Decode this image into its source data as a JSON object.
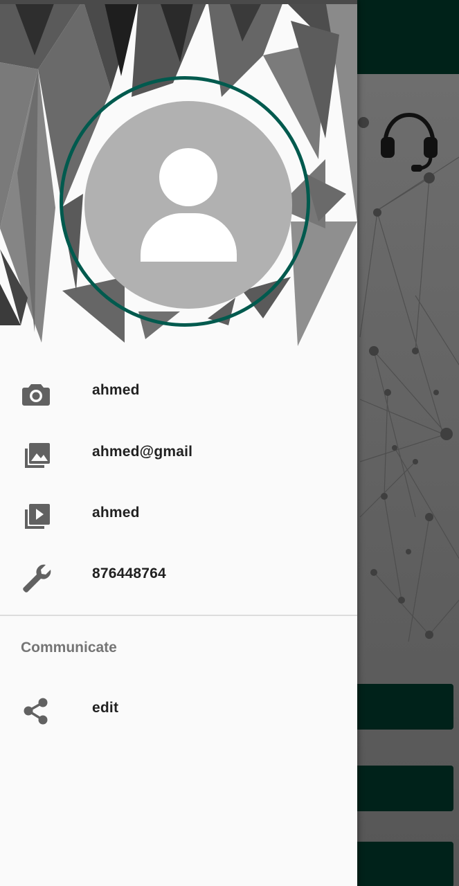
{
  "drawer": {
    "items": [
      {
        "label": "ahmed",
        "icon": "camera-icon"
      },
      {
        "label": "ahmed@gmail",
        "icon": "gallery-icon"
      },
      {
        "label": "ahmed",
        "icon": "slideshow-icon"
      },
      {
        "label": "876448764",
        "icon": "wrench-icon"
      }
    ],
    "section_title": "Communicate",
    "section_items": [
      {
        "label": "edit",
        "icon": "share-icon"
      }
    ]
  },
  "colors": {
    "accent_ring": "#005a4e",
    "toolbar": "#002219",
    "avatar_bg": "#b1b1b1"
  },
  "background_app": {
    "support_icon": "headset-icon"
  }
}
